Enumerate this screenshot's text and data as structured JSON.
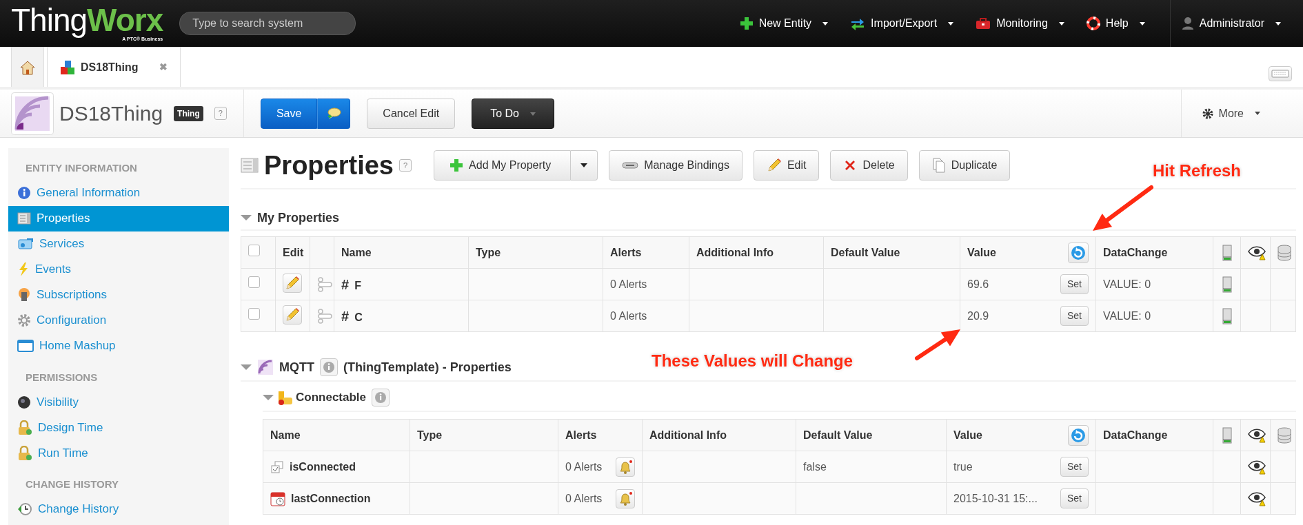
{
  "header": {
    "logo": {
      "word_1": "Thing",
      "word_2": "Worx",
      "tagline": "A PTC® Business"
    },
    "search": {
      "placeholder": "Type to search system"
    },
    "menu": [
      {
        "label": "New Entity",
        "kind": "plus"
      },
      {
        "label": "Import/Export",
        "kind": "transfer"
      },
      {
        "label": "Monitoring",
        "kind": "toolbox"
      },
      {
        "label": "Help",
        "kind": "help"
      },
      {
        "label": "Administrator",
        "kind": "user"
      }
    ]
  },
  "tabs": [
    {
      "label": "DS18Thing",
      "close": "✖",
      "selected": true
    }
  ],
  "entity": {
    "name": "DS18Thing",
    "type_badge": "Thing",
    "help": "?",
    "buttons": [
      {
        "label": "Save",
        "kind": "save"
      },
      {
        "label": "Cancel Edit",
        "kind": "plain"
      },
      {
        "label": "To Do",
        "kind": "dark"
      }
    ],
    "more": "More"
  },
  "sidebar": {
    "sections": [
      {
        "title": "ENTITY INFORMATION",
        "items": [
          {
            "label": "General Information",
            "kind": "info",
            "selected": false
          },
          {
            "label": "Properties",
            "kind": "properties",
            "selected": true
          },
          {
            "label": "Services",
            "kind": "services",
            "selected": false
          },
          {
            "label": "Events",
            "kind": "events",
            "selected": false
          },
          {
            "label": "Subscriptions",
            "kind": "subscriptions",
            "selected": false
          },
          {
            "label": "Configuration",
            "kind": "configuration",
            "selected": false
          },
          {
            "label": "Home Mashup",
            "kind": "mashup",
            "selected": false
          }
        ]
      },
      {
        "title": "PERMISSIONS",
        "items": [
          {
            "label": "Visibility",
            "kind": "visibility",
            "selected": false
          },
          {
            "label": "Design Time",
            "kind": "lock",
            "selected": false
          },
          {
            "label": "Run Time",
            "kind": "lock",
            "selected": false
          }
        ]
      },
      {
        "title": "CHANGE HISTORY",
        "items": [
          {
            "label": "Change History",
            "kind": "history",
            "selected": false
          }
        ]
      }
    ]
  },
  "page": {
    "title": "Properties",
    "help": "?",
    "toolbar": [
      {
        "label": "Add My Property",
        "kind": "add"
      },
      {
        "label": "Manage Bindings",
        "kind": "bindings"
      },
      {
        "label": "Edit",
        "kind": "edit"
      },
      {
        "label": "Delete",
        "kind": "delete"
      },
      {
        "label": "Duplicate",
        "kind": "duplicate"
      }
    ]
  },
  "my_properties": {
    "title": "My Properties",
    "expanded": true,
    "header_checked": false,
    "columns": [
      "Edit",
      "Name",
      "Type",
      "Alerts",
      "Additional Info",
      "Default Value",
      "Value",
      "DataChange"
    ],
    "rows": [
      {
        "checked": false,
        "type_symbol": "#",
        "name": "F",
        "alerts": "0 Alerts",
        "value": "69.6",
        "set": "Set",
        "data_change": "VALUE: 0"
      },
      {
        "checked": false,
        "type_symbol": "#",
        "name": "C",
        "alerts": "0 Alerts",
        "value": "20.9",
        "set": "Set",
        "data_change": "VALUE: 0"
      }
    ]
  },
  "template": {
    "name": "MQTT",
    "suffix": "(ThingTemplate) - Properties",
    "expanded": true,
    "shapes": [
      {
        "name": "Connectable",
        "expanded": true,
        "columns": [
          "Name",
          "Type",
          "Alerts",
          "Additional Info",
          "Default Value",
          "Value",
          "DataChange"
        ],
        "rows": [
          {
            "name": "isConnected",
            "kind": "boolean",
            "alerts": "0 Alerts",
            "default_value": "false",
            "value": "true",
            "set": "Set"
          },
          {
            "name": "lastConnection",
            "kind": "datetime",
            "alerts": "0 Alerts",
            "value": "2015-10-31 15:...",
            "set": "Set"
          }
        ]
      }
    ]
  },
  "annotations": [
    {
      "text": "Hit Refresh",
      "kind": "refresh"
    },
    {
      "text": "These Values will Change",
      "kind": "values"
    }
  ]
}
